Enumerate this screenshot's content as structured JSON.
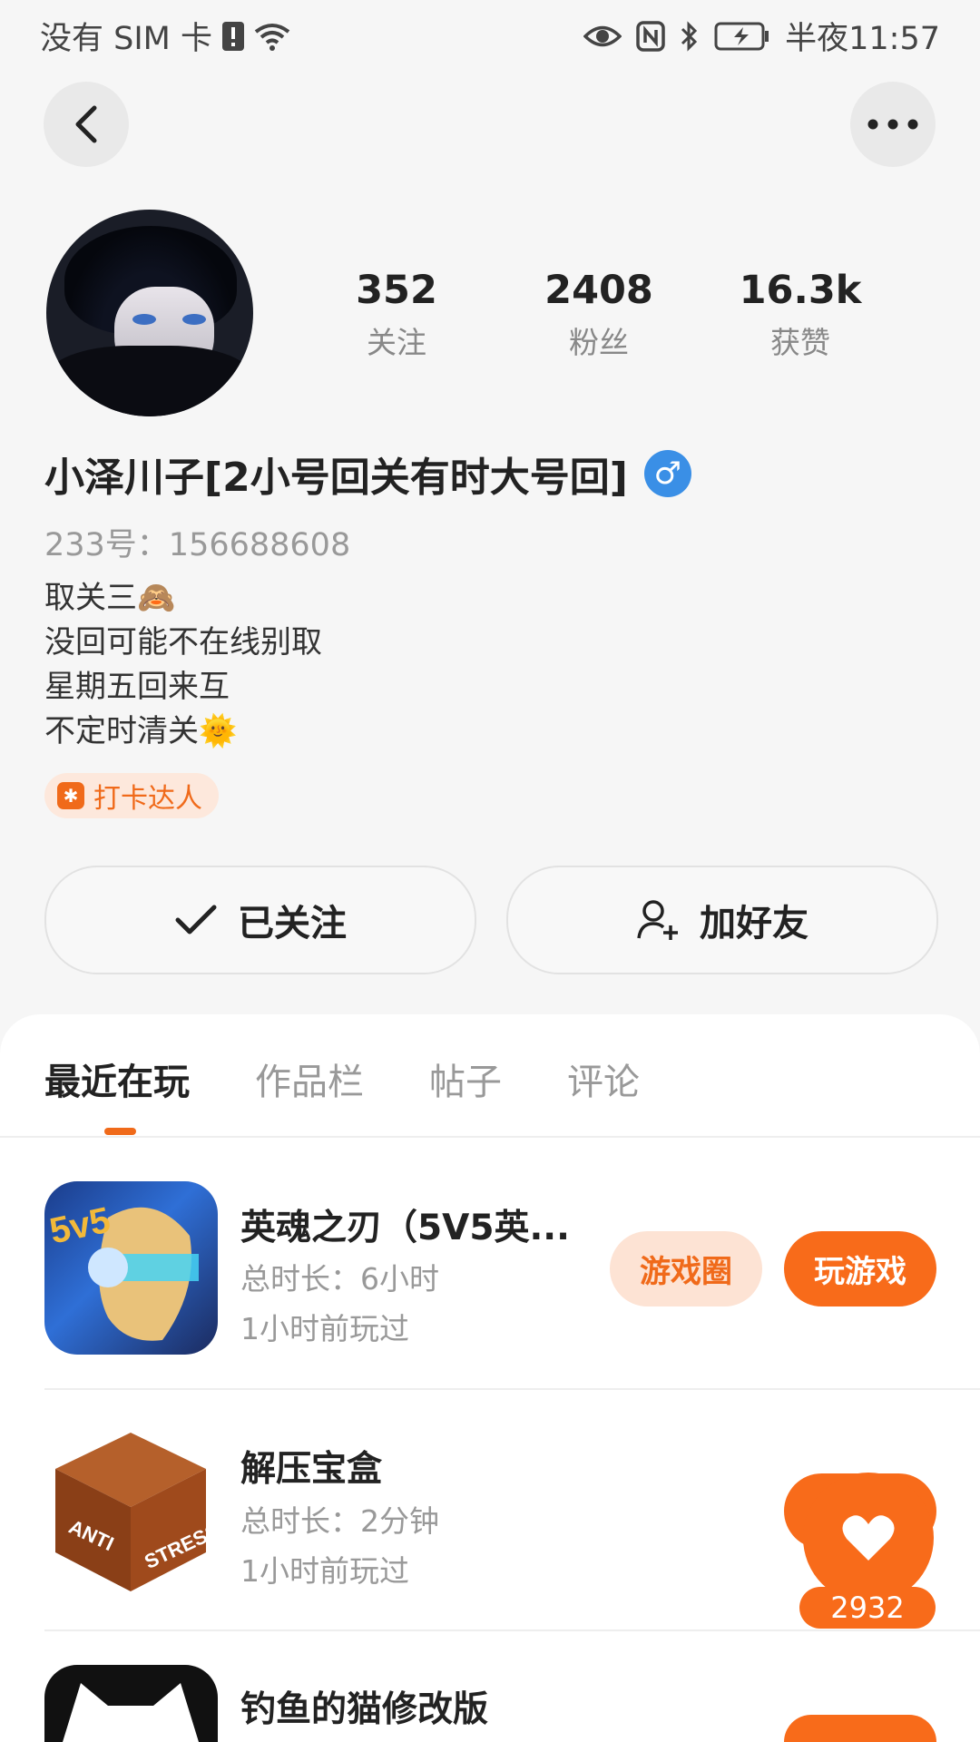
{
  "status_bar": {
    "carrier": "没有 SIM 卡",
    "time": "半夜11:57"
  },
  "profile": {
    "stats": [
      {
        "value": "352",
        "label": "关注"
      },
      {
        "value": "2408",
        "label": "粉丝"
      },
      {
        "value": "16.3k",
        "label": "获赞"
      }
    ],
    "name": "小泽川子[2小号回关有时大号回]",
    "gender_symbol": "♂",
    "uid": "233号：156688608",
    "bio_lines": [
      "取关三🙈",
      "没回可能不在线别取",
      "星期五回来互",
      "不定时清关🌞"
    ],
    "badge": "打卡达人"
  },
  "actions": {
    "followed": "已关注",
    "add_friend": "加好友"
  },
  "tabs": [
    "最近在玩",
    "作品栏",
    "帖子",
    "评论"
  ],
  "games": [
    {
      "title": "英魂之刃（5V5英...",
      "duration": "总时长：6小时",
      "last_played": "1小时前玩过",
      "circle_label": "游戏圈",
      "play_label": "玩游戏"
    },
    {
      "title": "解压宝盒",
      "duration": "总时长：2分钟",
      "last_played": "1小时前玩过"
    },
    {
      "title": "钓鱼的猫修改版"
    }
  ],
  "like_count": "2932",
  "colors": {
    "accent": "#f86b1a",
    "accent_light": "#fde3d4",
    "gender_blue": "#3a8fe6"
  }
}
